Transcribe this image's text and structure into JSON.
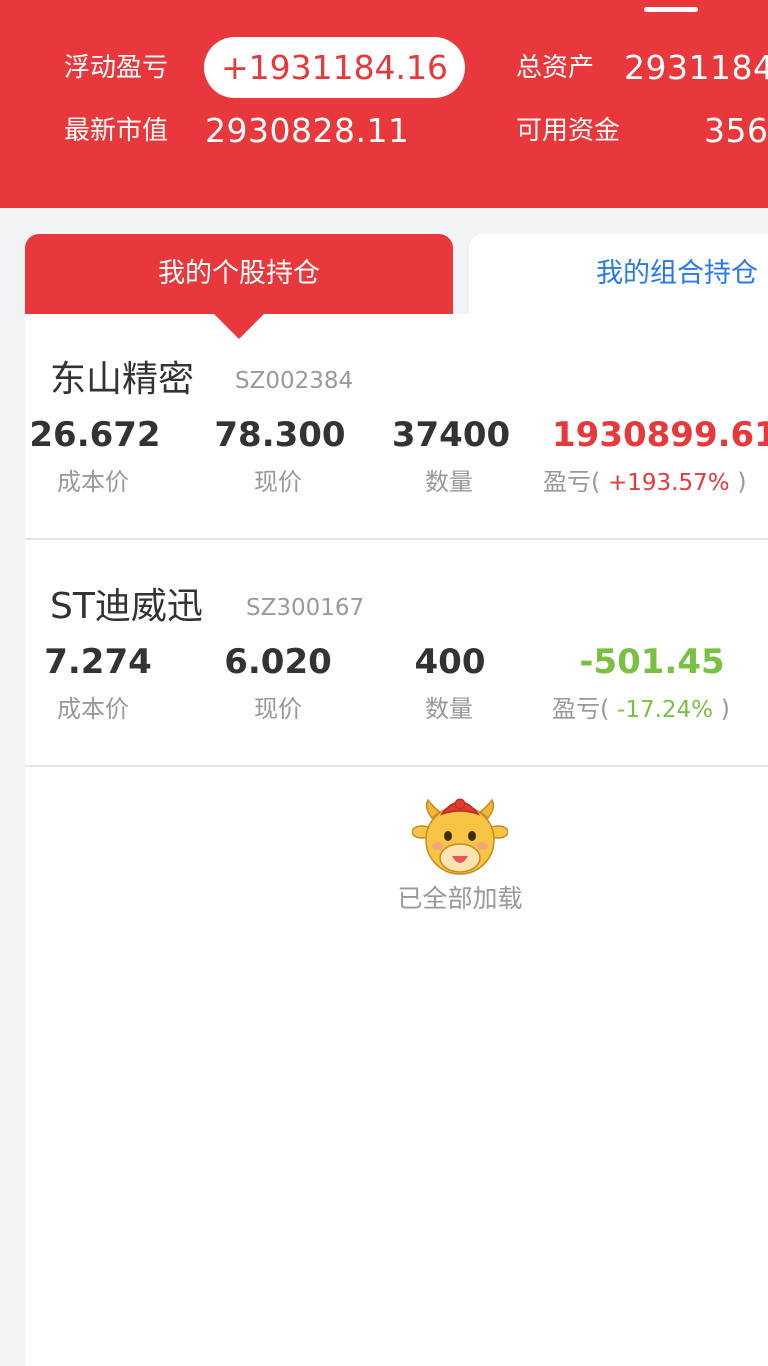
{
  "header": {
    "floating_pnl_label": "浮动盈亏",
    "floating_pnl_value": "+1931184.16",
    "total_assets_label": "总资产",
    "total_assets_value": "2931184",
    "market_value_label": "最新市值",
    "market_value_value": "2930828.11",
    "available_funds_label": "可用资金",
    "available_funds_value": "356"
  },
  "tabs": {
    "stock_holdings": "我的个股持仓",
    "portfolio_holdings": "我的组合持仓"
  },
  "holdings": [
    {
      "name": "东山精密",
      "code": "SZ002384",
      "cost": "26.672",
      "cost_label": "成本价",
      "price": "78.300",
      "price_label": "现价",
      "quantity": "37400",
      "quantity_label": "数量",
      "pnl": "1930899.61",
      "pnl_label": "盈亏(",
      "pnl_pct": "+193.57%",
      "pnl_close": ")",
      "trend": "up"
    },
    {
      "name": "ST迪威迅",
      "code": "SZ300167",
      "cost": "7.274",
      "cost_label": "成本价",
      "price": "6.020",
      "price_label": "现价",
      "quantity": "400",
      "quantity_label": "数量",
      "pnl": "-501.45",
      "pnl_label": "盈亏(",
      "pnl_pct": "-17.24%",
      "pnl_close": ")",
      "trend": "down"
    }
  ],
  "footer": {
    "loaded_text": "已全部加载",
    "mascot_icon": "cow-mascot-icon"
  },
  "colors": {
    "brand_red": "#e8383b",
    "profit_red": "#e8383b",
    "loss_green": "#7ac143",
    "tab_blue": "#2979e8"
  }
}
